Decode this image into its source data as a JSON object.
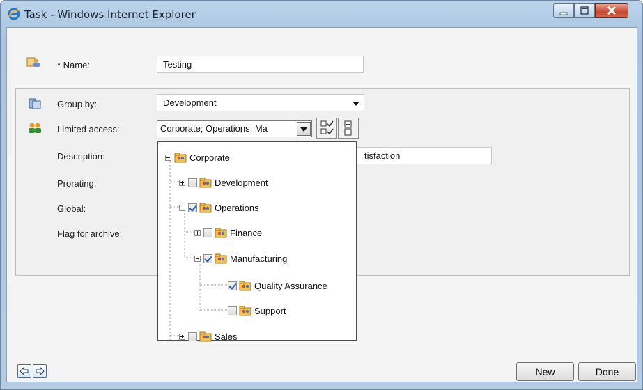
{
  "window": {
    "title": "Task - Windows Internet Explorer"
  },
  "form": {
    "name_label": "* Name:",
    "name_value": "Testing",
    "group_by_label": "Group by:",
    "group_by_value": "Development",
    "limited_access_label": "Limited access:",
    "limited_access_value": "Corporate; Operations; Ma",
    "description_label": "Description:",
    "description_value_visible": "tisfaction",
    "prorating_label": "Prorating:",
    "global_label": "Global:",
    "flag_archive_label": "Flag for archive:"
  },
  "tree": {
    "nodes": [
      {
        "label": "Corporate",
        "checked": null,
        "expander": "minus"
      },
      {
        "label": "Development",
        "checked": false,
        "expander": "plus"
      },
      {
        "label": "Operations",
        "checked": true,
        "expander": "minus"
      },
      {
        "label": "Finance",
        "checked": false,
        "expander": "plus"
      },
      {
        "label": "Manufacturing",
        "checked": true,
        "expander": "minus"
      },
      {
        "label": "Quality Assurance",
        "checked": true,
        "expander": null
      },
      {
        "label": "Support",
        "checked": false,
        "expander": null
      },
      {
        "label": "Sales",
        "checked": false,
        "expander": "plus"
      }
    ]
  },
  "buttons": {
    "new_label": "New",
    "done_label": "Done"
  },
  "icons": {
    "ie": "ie-logo-icon",
    "name": "task-user-icon",
    "group": "group-icon",
    "access": "users-access-icon",
    "folder": "org-folder-icon",
    "check_all": "check-all-icon",
    "expand_all": "expand-all-icon"
  },
  "colors": {
    "titlebar": "#a9c4e0",
    "close": "#c4472e",
    "check": "#2a5fb0"
  }
}
